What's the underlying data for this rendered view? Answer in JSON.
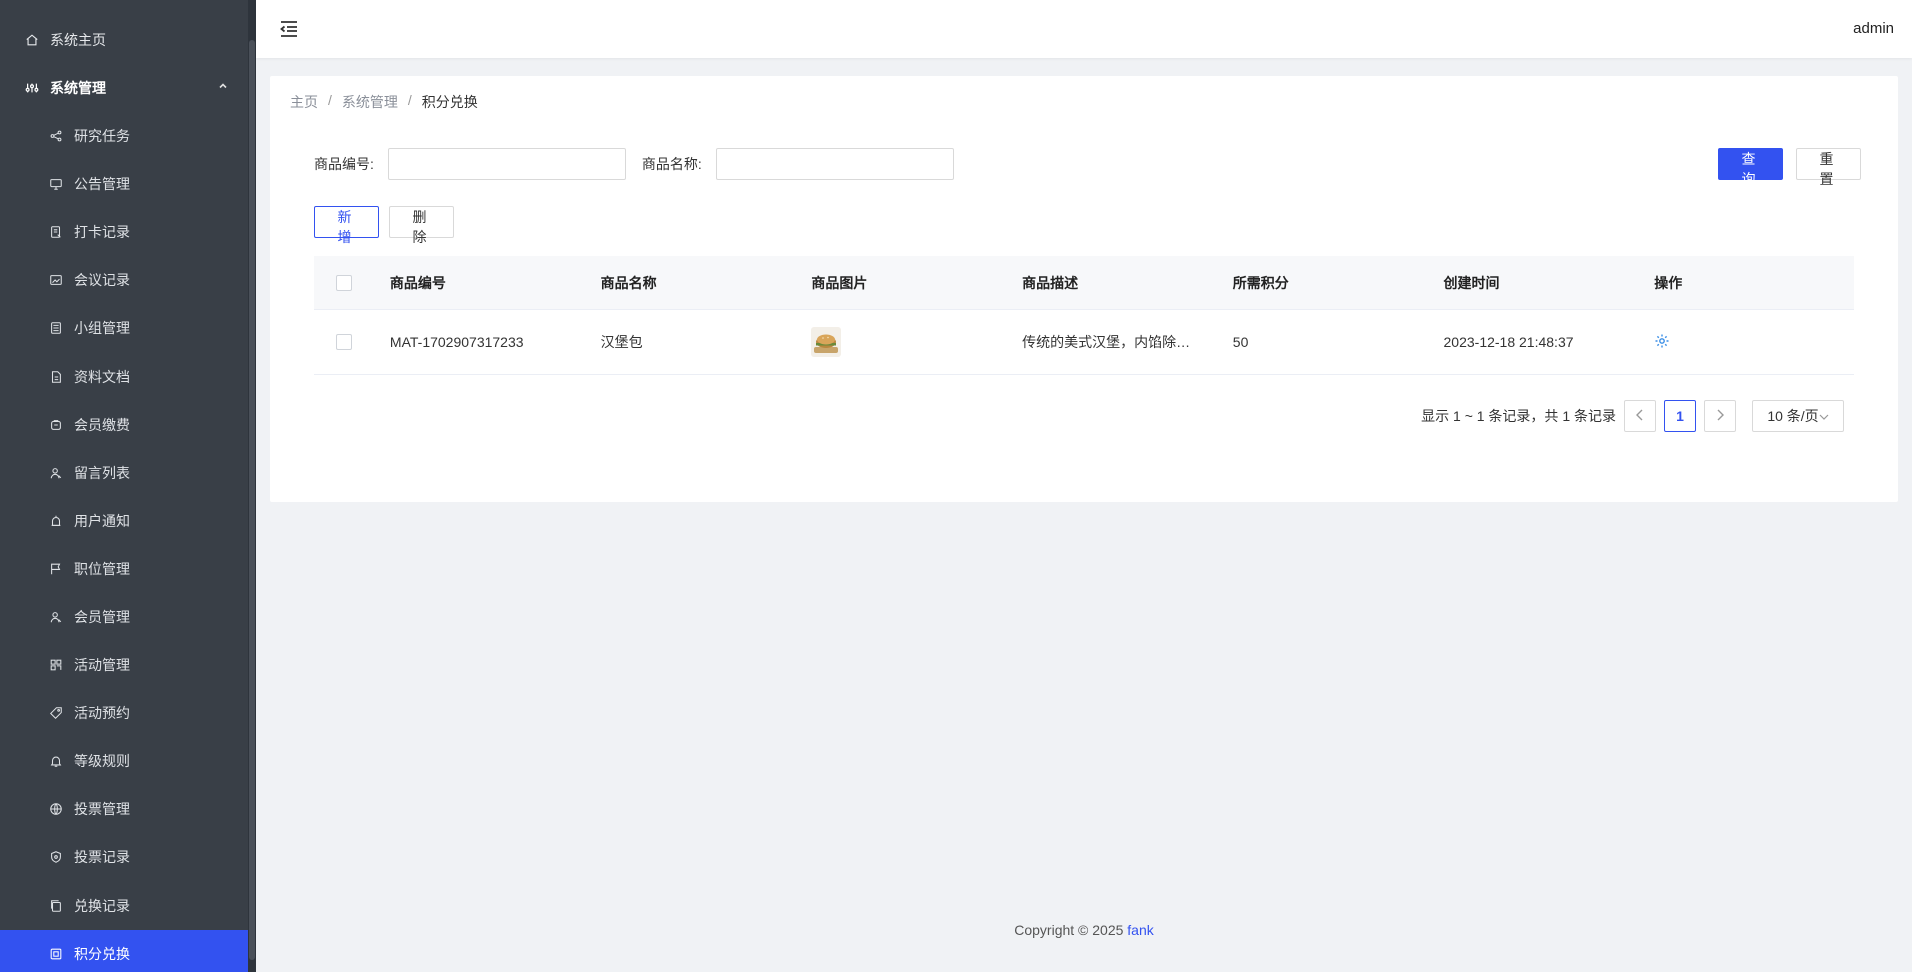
{
  "sidebar": {
    "home": "系统主页",
    "group": "系统管理",
    "items": [
      {
        "label": "研究任务",
        "icon": "share-icon"
      },
      {
        "label": "公告管理",
        "icon": "monitor-icon"
      },
      {
        "label": "打卡记录",
        "icon": "receipt-icon"
      },
      {
        "label": "会议记录",
        "icon": "picture-icon"
      },
      {
        "label": "小组管理",
        "icon": "list-icon"
      },
      {
        "label": "资料文档",
        "icon": "document-icon"
      },
      {
        "label": "会员缴费",
        "icon": "wallet-icon"
      },
      {
        "label": "留言列表",
        "icon": "user-icon"
      },
      {
        "label": "用户通知",
        "icon": "alarm-icon"
      },
      {
        "label": "职位管理",
        "icon": "flag-icon"
      },
      {
        "label": "会员管理",
        "icon": "user-icon"
      },
      {
        "label": "活动管理",
        "icon": "grid-icon"
      },
      {
        "label": "活动预约",
        "icon": "tag-icon"
      },
      {
        "label": "等级规则",
        "icon": "bell-icon"
      },
      {
        "label": "投票管理",
        "icon": "globe-icon"
      },
      {
        "label": "投票记录",
        "icon": "shield-icon"
      },
      {
        "label": "兑换记录",
        "icon": "copy-icon"
      },
      {
        "label": "积分兑换",
        "icon": "frame-icon",
        "active": true
      }
    ]
  },
  "header": {
    "user": "admin"
  },
  "breadcrumb": {
    "home": "主页",
    "section": "系统管理",
    "current": "积分兑换"
  },
  "search": {
    "code_label": "商品编号:",
    "code_value": "",
    "name_label": "商品名称:",
    "name_value": "",
    "query": "查询",
    "reset": "重置"
  },
  "toolbar": {
    "add": "新增",
    "delete": "删除"
  },
  "table": {
    "headers": [
      "商品编号",
      "商品名称",
      "商品图片",
      "商品描述",
      "所需积分",
      "创建时间",
      "操作"
    ],
    "rows": [
      {
        "code": "MAT-1702907317233",
        "name": "汉堡包",
        "desc": "传统的美式汉堡，内馅除…",
        "points": "50",
        "created": "2023-12-18 21:48:37"
      }
    ]
  },
  "pager": {
    "summary": "显示 1 ~ 1 条记录，共 1 条记录",
    "page": "1",
    "size": "10 条/页"
  },
  "footer": {
    "copyright": "Copyright © 2025",
    "brand": "fank"
  },
  "colors": {
    "accent": "#3352f0",
    "sidebar": "#393f47"
  }
}
